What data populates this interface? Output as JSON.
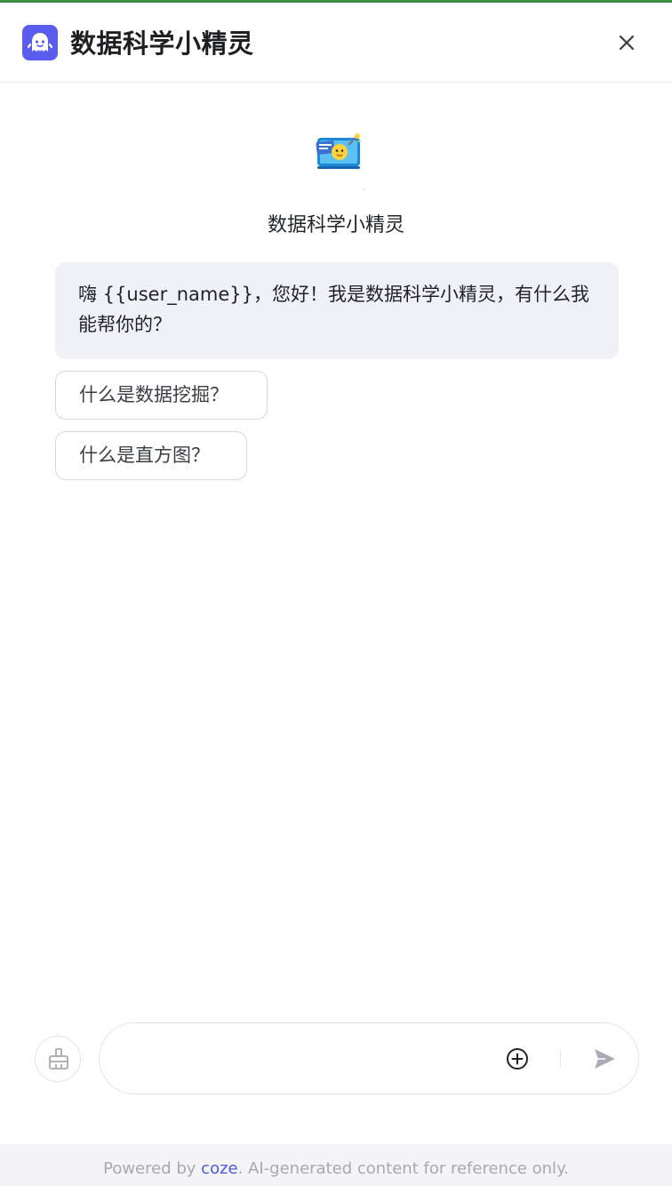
{
  "header": {
    "title": "数据科学小精灵",
    "logo_icon": "coze-bot-icon",
    "close_icon": "close-icon"
  },
  "bot": {
    "name": "数据科学小精灵",
    "avatar_icon": "data-science-bot-avatar"
  },
  "greeting": {
    "text": "嗨 {{user_name}}，您好！我是数据科学小精灵，有什么我能帮你的？"
  },
  "suggestions": [
    {
      "label": "什么是数据挖掘？"
    },
    {
      "label": "什么是直方图？"
    }
  ],
  "input": {
    "placeholder": "",
    "value": "",
    "clear_icon": "broom-icon",
    "add_icon": "plus-circle-icon",
    "send_icon": "send-icon"
  },
  "footer": {
    "prefix": "Powered by ",
    "link_text": "coze",
    "suffix": ". AI-generated content for reference only."
  },
  "colors": {
    "accent": "#5a5cf0",
    "bubble_bg": "#f0f1f6",
    "link": "#4b58dc",
    "top_border": "#3a8f3c"
  }
}
